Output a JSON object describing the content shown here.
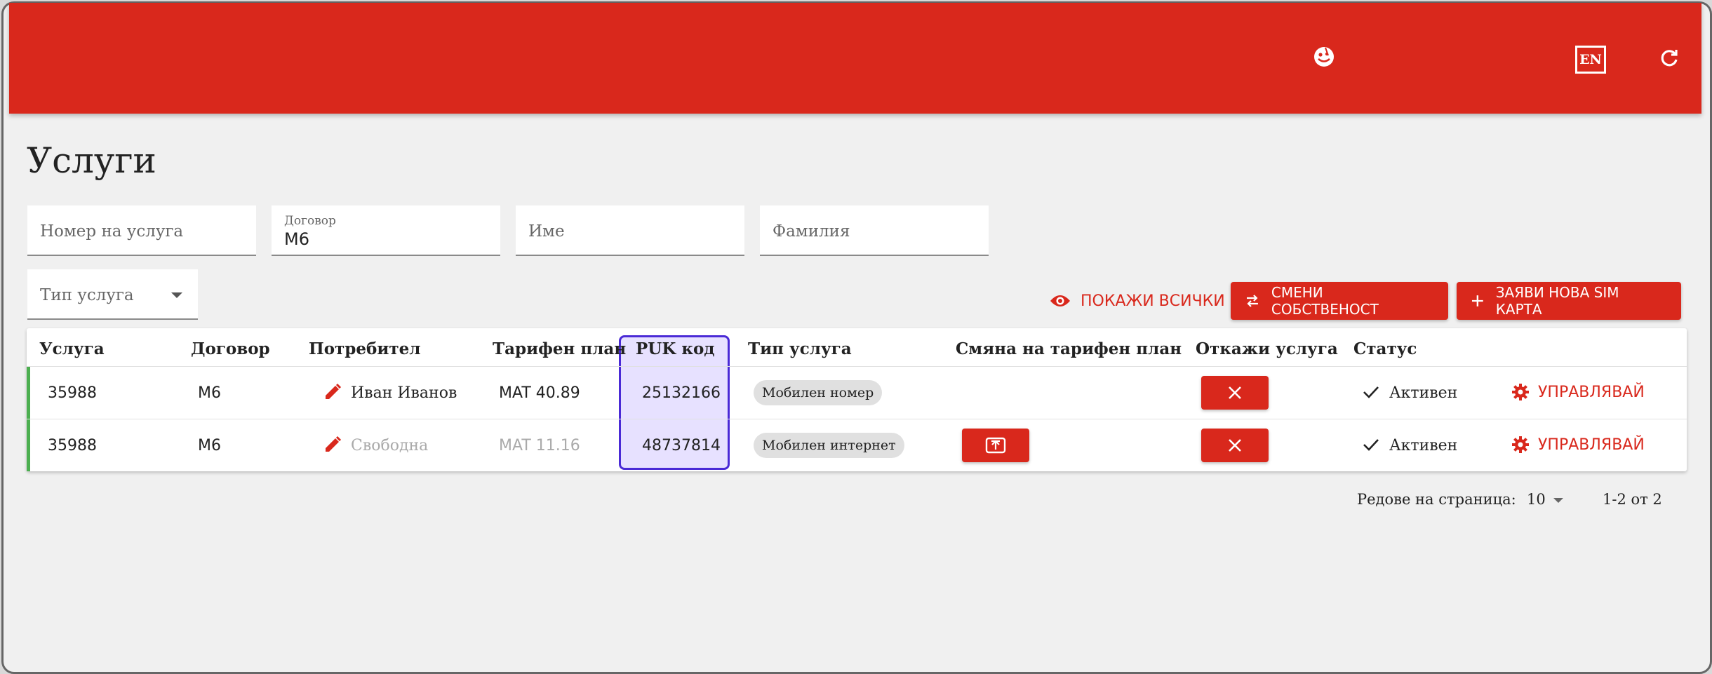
{
  "topbar": {
    "lang_label": "EN",
    "icons": [
      "face-icon",
      "refresh-icon"
    ],
    "color": "#d9281c"
  },
  "page_title": "Услуги",
  "filters": {
    "service_number_placeholder": "Номер на услуга",
    "contract_label": "Договор",
    "contract_value": "M6",
    "name_placeholder": "Име",
    "surname_placeholder": "Фамилия",
    "service_type_placeholder": "Тип услуга"
  },
  "actions": {
    "show_all": "ПОКАЖИ ВСИЧКИ",
    "change_ownership": "СМЕНИ СОБСТВЕНОСТ",
    "request_sim": "ЗАЯВИ НОВА SIM КАРТА"
  },
  "table": {
    "headers": [
      "Услуга",
      "Договор",
      "Потребител",
      "Тарифен план",
      "PUK код",
      "Тип услуга",
      "Смяна на тарифен план",
      "Откажи услуга",
      "Статус"
    ],
    "rows": [
      {
        "service": "35988",
        "contract": "M6",
        "user": "Иван Иванов",
        "plan": "MAT 40.89",
        "puk": "25132166",
        "type": "Мобилен номер",
        "status": "Активен",
        "manage": "УПРАВЛЯВАЙ"
      },
      {
        "service": "35988",
        "contract": "M6",
        "user": "Свободна",
        "plan": "MAT 11.16",
        "puk": "48737814",
        "type": "Мобилен интернет",
        "status": "Активен",
        "manage": "УПРАВЛЯВАЙ"
      }
    ],
    "highlighted_column": "PUK код",
    "highlight_color": "#4a2ad6",
    "active_color": "#4caf50"
  },
  "pagination": {
    "rows_per_page_label": "Редове на страница:",
    "rows_per_page": "10",
    "range": "1-2 от 2"
  }
}
